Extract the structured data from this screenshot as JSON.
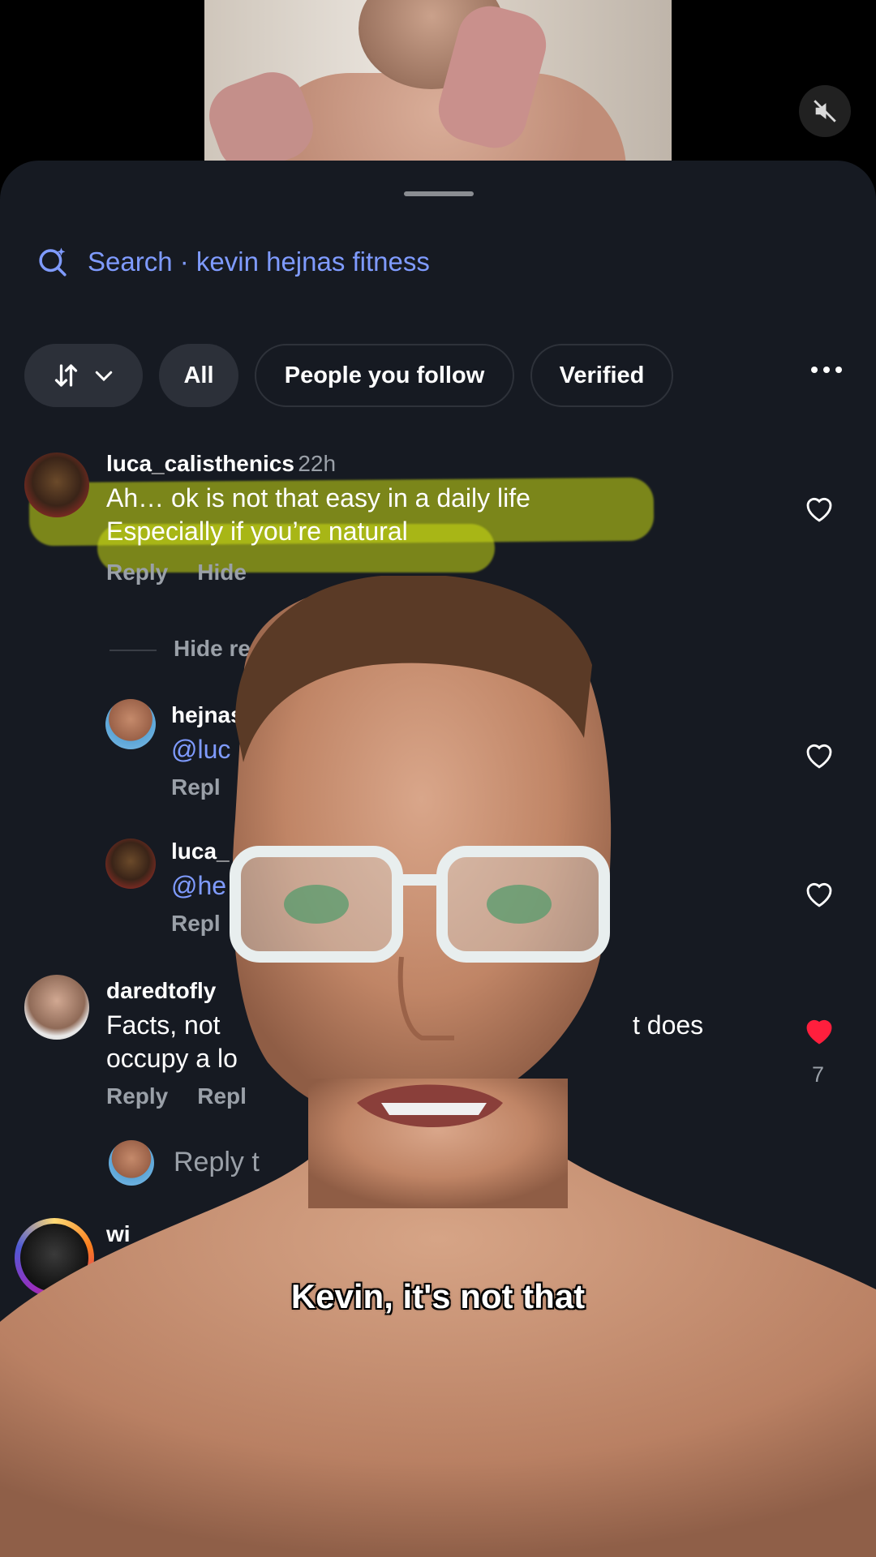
{
  "search": {
    "label": "Search · kevin hejnas fitness"
  },
  "filters": {
    "all": "All",
    "people_you_follow": "People you follow",
    "verified": "Verified"
  },
  "comments": [
    {
      "user": "luca_calisthenics",
      "time": "22h",
      "line1": "Ah… ok is not that easy in a daily life",
      "line2": "Especially if you’re natural",
      "reply": "Reply",
      "hide": "Hide"
    },
    {
      "hide_replies": "Hide re"
    },
    {
      "user": "hejnas",
      "mention": "@luc",
      "reply": "Repl"
    },
    {
      "user": "luca_",
      "mention": "@he",
      "reply": "Repl"
    },
    {
      "user": "daredtofly",
      "line1a": "Facts, not",
      "line1b": "t does",
      "line2": "occupy a lo",
      "reply": "Reply",
      "reply2": "Repl",
      "likes": "7"
    },
    {
      "reply_to": "Reply t"
    },
    {
      "user": "wi"
    }
  ],
  "caption": "Kevin, it's not that",
  "colors": {
    "accent": "#7f9bff",
    "liked": "#ff1f3d",
    "sheet_bg": "#161a22",
    "highlight": "#cdde14"
  },
  "icons": {
    "search": "ai-search-icon",
    "sort": "sort-arrows-icon",
    "mute": "speaker-muted-icon",
    "like": "heart-outline-icon",
    "liked": "heart-filled-icon"
  }
}
